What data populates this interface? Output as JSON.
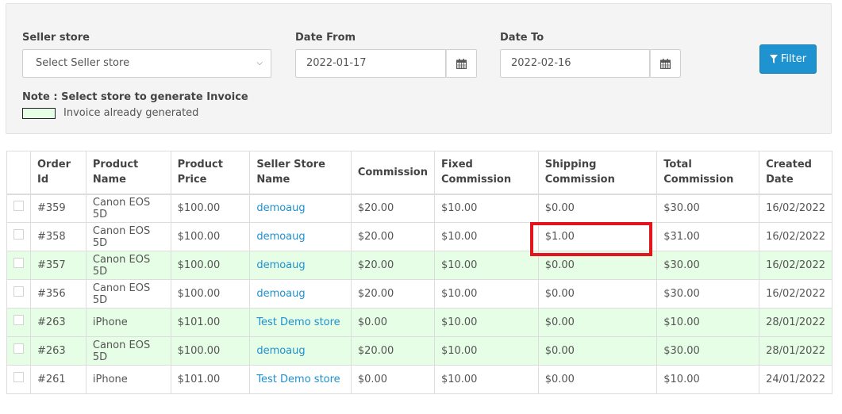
{
  "filters": {
    "seller_store": {
      "label": "Seller store",
      "value": "Select Seller store"
    },
    "date_from": {
      "label": "Date From",
      "value": "2022-01-17"
    },
    "date_to": {
      "label": "Date To",
      "value": "2022-02-16"
    },
    "filter_button": {
      "label": "Filter",
      "icon": "filter-icon"
    },
    "note": "Note : Select store to generate Invoice",
    "legend": {
      "text": "Invoice already generated",
      "color": "#e6fde6"
    }
  },
  "table": {
    "columns": [
      "Order Id",
      "Product Name",
      "Product Price",
      "Seller Store Name",
      "Commission",
      "Fixed Commission",
      "Shipping Commission",
      "Total Commission",
      "Created Date"
    ],
    "columns_wrapped": [
      [
        "Order",
        "Id"
      ],
      [
        "Product",
        "Name"
      ],
      [
        "Product",
        "Price"
      ],
      [
        "Seller Store",
        "Name"
      ],
      [
        "Commission",
        ""
      ],
      [
        "Fixed",
        "Commission"
      ],
      [
        "Shipping",
        "Commission"
      ],
      [
        "Total",
        "Commission"
      ],
      [
        "Created",
        "Date"
      ]
    ],
    "rows": [
      {
        "order_id": "#359",
        "product": "Canon EOS 5D",
        "price": "$100.00",
        "store": "demoaug",
        "commission": "$20.00",
        "fixed": "$10.00",
        "shipping": "$0.00",
        "total": "$30.00",
        "date": "16/02/2022",
        "generated": false
      },
      {
        "order_id": "#358",
        "product": "Canon EOS 5D",
        "price": "$100.00",
        "store": "demoaug",
        "commission": "$20.00",
        "fixed": "$10.00",
        "shipping": "$1.00",
        "total": "$31.00",
        "date": "16/02/2022",
        "generated": false,
        "highlighted_cell": "shipping"
      },
      {
        "order_id": "#357",
        "product": "Canon EOS 5D",
        "price": "$100.00",
        "store": "demoaug",
        "commission": "$20.00",
        "fixed": "$10.00",
        "shipping": "$0.00",
        "total": "$30.00",
        "date": "16/02/2022",
        "generated": true
      },
      {
        "order_id": "#356",
        "product": "Canon EOS 5D",
        "price": "$100.00",
        "store": "demoaug",
        "commission": "$20.00",
        "fixed": "$10.00",
        "shipping": "$0.00",
        "total": "$30.00",
        "date": "16/02/2022",
        "generated": false
      },
      {
        "order_id": "#263",
        "product": "iPhone",
        "price": "$101.00",
        "store": "Test Demo store",
        "commission": "$0.00",
        "fixed": "$10.00",
        "shipping": "$0.00",
        "total": "$10.00",
        "date": "28/01/2022",
        "generated": true
      },
      {
        "order_id": "#263",
        "product": "Canon EOS 5D",
        "price": "$100.00",
        "store": "demoaug",
        "commission": "$20.00",
        "fixed": "$10.00",
        "shipping": "$0.00",
        "total": "$30.00",
        "date": "28/01/2022",
        "generated": true
      },
      {
        "order_id": "#261",
        "product": "iPhone",
        "price": "$101.00",
        "store": "Test Demo store",
        "commission": "$0.00",
        "fixed": "$10.00",
        "shipping": "$0.00",
        "total": "$10.00",
        "date": "24/01/2022",
        "generated": false
      }
    ]
  },
  "colors": {
    "accent": "#1f92d0",
    "link": "#1e91cf",
    "generated_row": "#e6fde6",
    "highlight": "#e3141e"
  }
}
